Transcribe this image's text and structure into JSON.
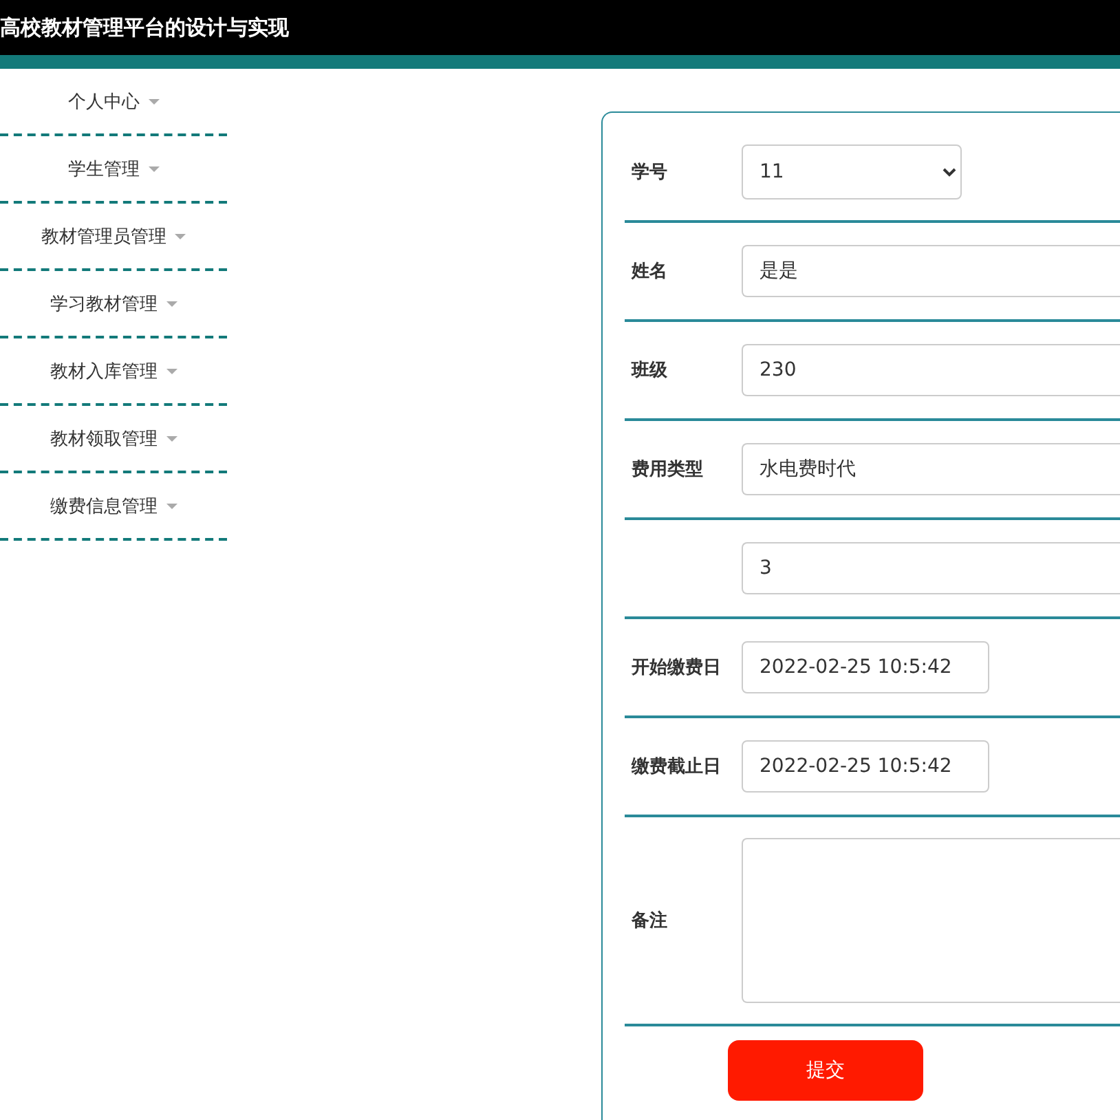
{
  "header": {
    "title": "高校教材管理平台的设计与实现"
  },
  "sidebar": {
    "items": [
      {
        "label": "个人中心"
      },
      {
        "label": "学生管理"
      },
      {
        "label": "教材管理员管理"
      },
      {
        "label": "学习教材管理"
      },
      {
        "label": "教材入库管理"
      },
      {
        "label": "教材领取管理"
      },
      {
        "label": "缴费信息管理"
      }
    ]
  },
  "form": {
    "fields": [
      {
        "kind": "select",
        "label": "学号",
        "value": "11"
      },
      {
        "kind": "text",
        "label": "姓名",
        "value": "是是"
      },
      {
        "kind": "text",
        "label": "班级",
        "value": "230"
      },
      {
        "kind": "text",
        "label": "费用类型",
        "value": "水电费时代"
      },
      {
        "kind": "text",
        "value": "3"
      },
      {
        "kind": "date",
        "label": "开始缴费日",
        "value": "2022-02-25 10:5:42"
      },
      {
        "kind": "date",
        "label": "缴费截止日",
        "value": "2022-02-25 10:5:42"
      },
      {
        "kind": "textarea",
        "label": "备注"
      }
    ],
    "submit": "提交"
  }
}
